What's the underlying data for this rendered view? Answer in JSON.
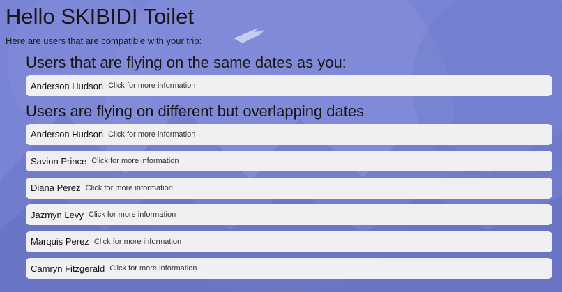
{
  "greeting": "Hello SKIBIDI Toilet",
  "subtitle": "Here are users that are compatible with your trip:",
  "same_dates": {
    "heading": "Users that are flying on the same dates as you:",
    "users": [
      {
        "name": "Anderson Hudson",
        "action": "Click for more information"
      }
    ]
  },
  "overlapping_dates": {
    "heading": "Users are flying on different but overlapping dates",
    "users": [
      {
        "name": "Anderson Hudson",
        "action": "Click for more information"
      },
      {
        "name": "Savion Prince",
        "action": "Click for more information"
      },
      {
        "name": "Diana Perez",
        "action": "Click for more information"
      },
      {
        "name": "Jazmyn Levy",
        "action": "Click for more information"
      },
      {
        "name": "Marquis Perez",
        "action": "Click for more information"
      },
      {
        "name": "Camryn Fitzgerald",
        "action": "Click for more information"
      }
    ]
  },
  "colors": {
    "background": "#7d86d6",
    "card": "#f0f0f2"
  }
}
